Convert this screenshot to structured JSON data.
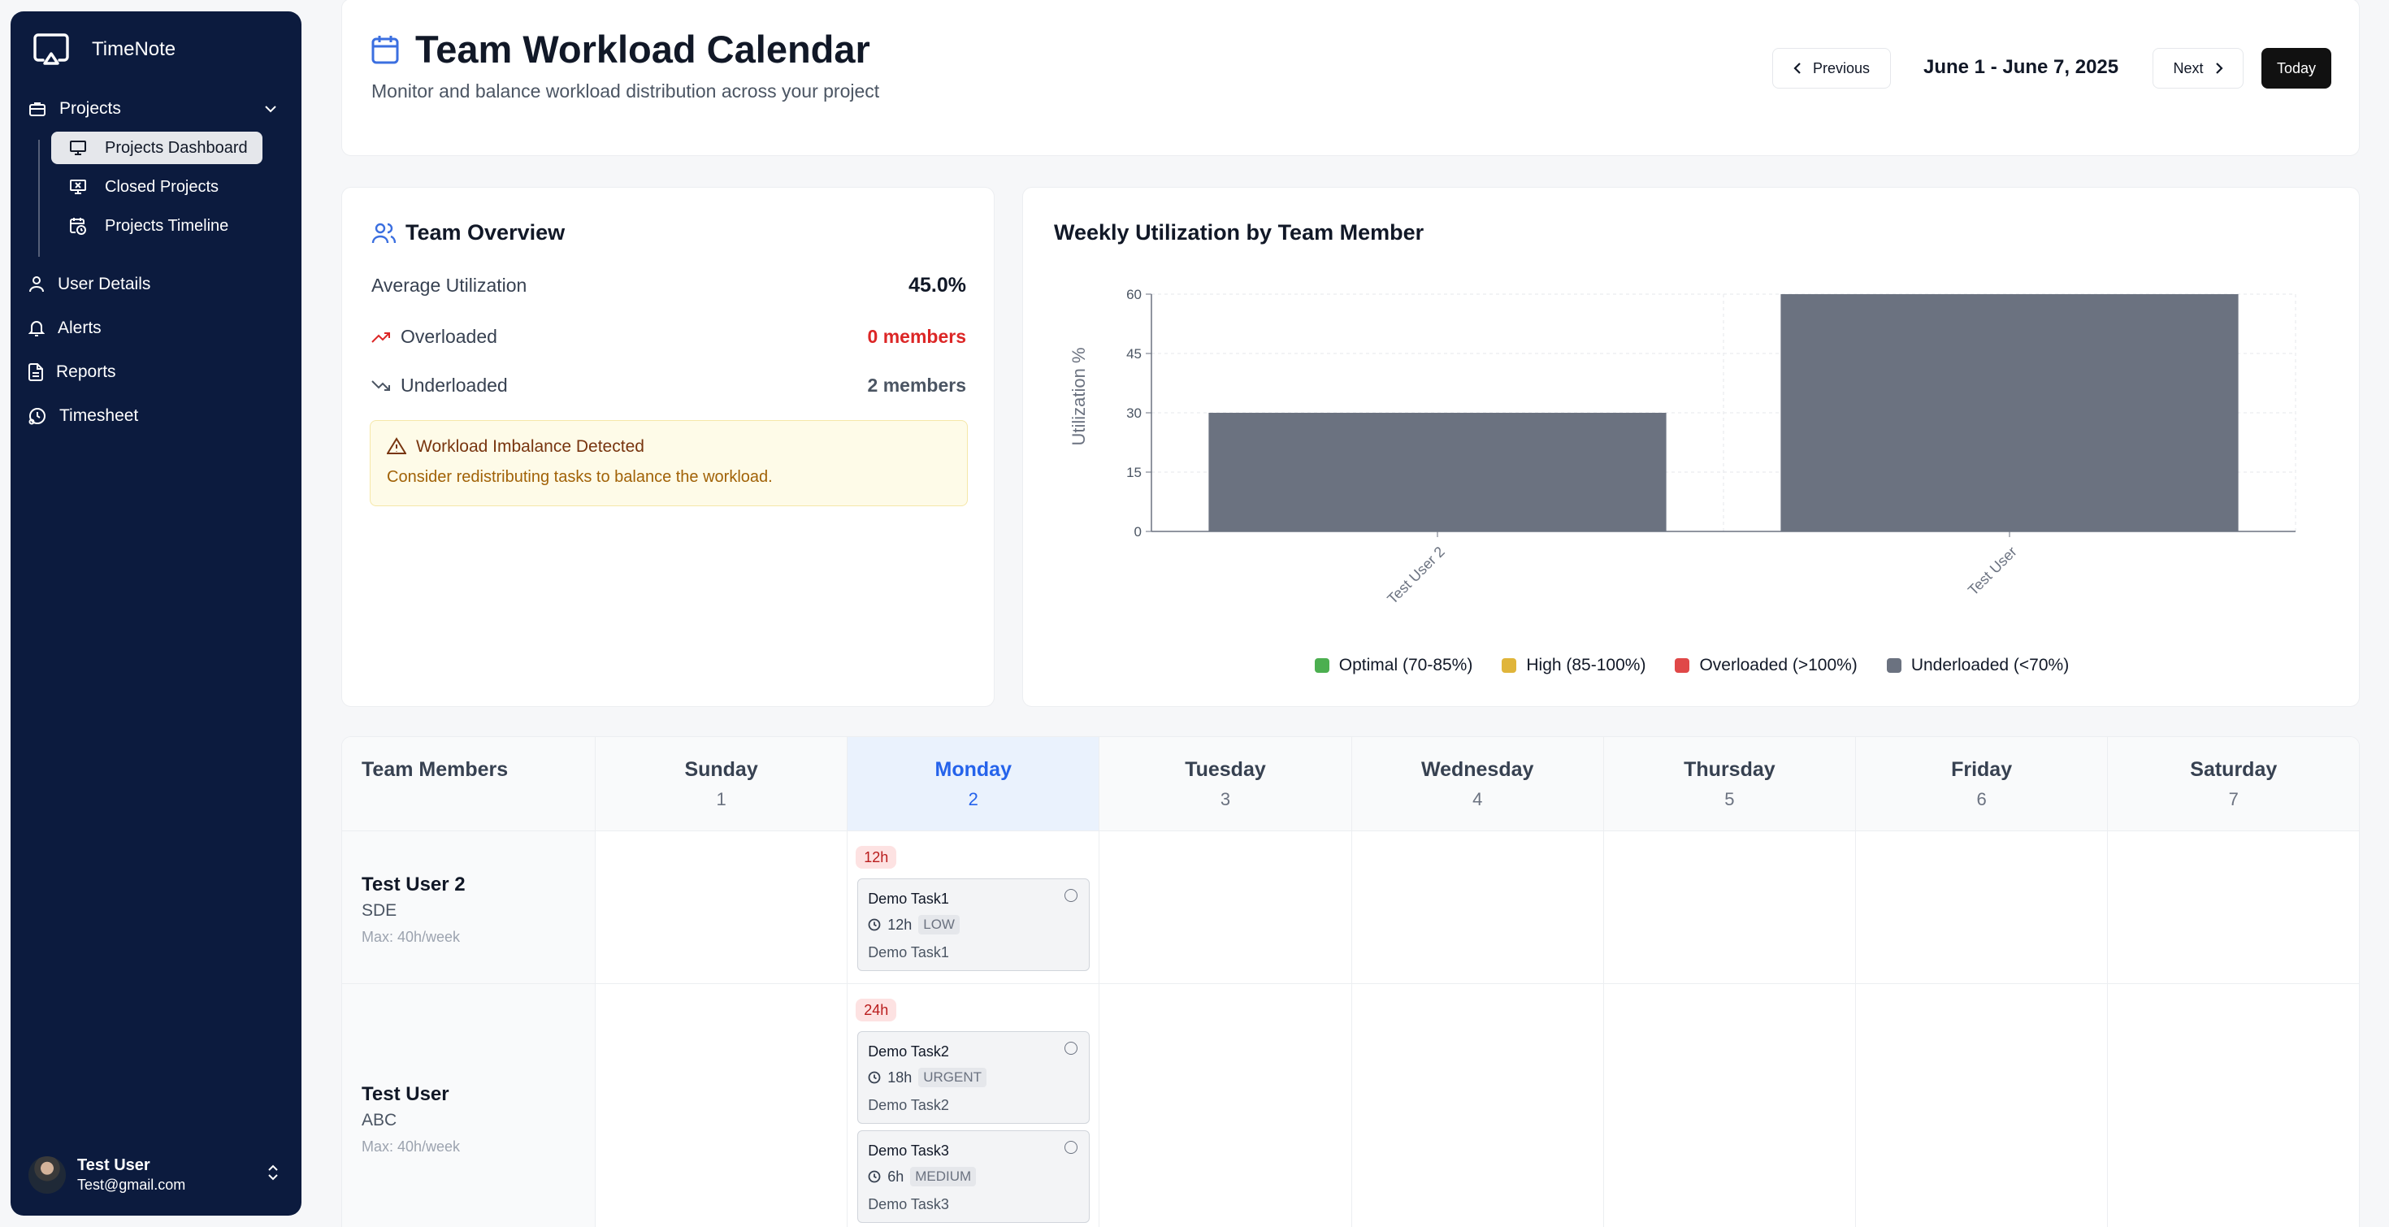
{
  "sidebar": {
    "brand": "TimeNote",
    "projects_label": "Projects",
    "sub_items": [
      "Projects Dashboard",
      "Closed Projects",
      "Projects Timeline"
    ],
    "items": [
      "User Details",
      "Alerts",
      "Reports",
      "Timesheet"
    ],
    "user": {
      "name": "Test User",
      "email": "Test@gmail.com"
    }
  },
  "header": {
    "title": "Team Workload Calendar",
    "subtitle": "Monitor and balance workload distribution across your project",
    "previous_label": "Previous",
    "date_range": "June 1 - June 7, 2025",
    "next_label": "Next",
    "today_label": "Today"
  },
  "overview": {
    "title": "Team Overview",
    "avg_label": "Average Utilization",
    "avg_value": "45.0%",
    "overloaded_label": "Overloaded",
    "overloaded_value": "0 members",
    "underloaded_label": "Underloaded",
    "underloaded_value": "2 members",
    "alert_title": "Workload Imbalance Detected",
    "alert_text": "Consider redistributing tasks to balance the workload."
  },
  "chart_data": {
    "type": "bar",
    "title": "Weekly Utilization by Team Member",
    "ylabel": "Utilization %",
    "categories": [
      "Test User 2",
      "Test User"
    ],
    "values": [
      30,
      60
    ],
    "ylim": [
      0,
      60
    ],
    "yticks": [
      0,
      15,
      30,
      45,
      60
    ],
    "grid": true,
    "bar_color": "#6b7280",
    "legend": [
      {
        "label": "Optimal (70-85%)",
        "color": "#4caf50"
      },
      {
        "label": "High (85-100%)",
        "color": "#e0b53a"
      },
      {
        "label": "Overloaded (>100%)",
        "color": "#e04848"
      },
      {
        "label": "Underloaded (<70%)",
        "color": "#6b7280"
      }
    ]
  },
  "calendar": {
    "members_header": "Team Members",
    "days": [
      {
        "name": "Sunday",
        "num": "1"
      },
      {
        "name": "Monday",
        "num": "2"
      },
      {
        "name": "Tuesday",
        "num": "3"
      },
      {
        "name": "Wednesday",
        "num": "4"
      },
      {
        "name": "Thursday",
        "num": "5"
      },
      {
        "name": "Friday",
        "num": "6"
      },
      {
        "name": "Saturday",
        "num": "7"
      }
    ],
    "members": [
      {
        "name": "Test User 2",
        "role": "SDE",
        "max": "Max: 40h/week",
        "monday_total": "12h",
        "tasks": [
          {
            "name": "Demo Task1",
            "hours": "12h",
            "priority": "LOW",
            "desc": "Demo Task1"
          }
        ]
      },
      {
        "name": "Test User",
        "role": "ABC",
        "max": "Max: 40h/week",
        "monday_total": "24h",
        "tasks": [
          {
            "name": "Demo Task2",
            "hours": "18h",
            "priority": "URGENT",
            "desc": "Demo Task2"
          },
          {
            "name": "Demo Task3",
            "hours": "6h",
            "priority": "MEDIUM",
            "desc": "Demo Task3"
          }
        ]
      }
    ]
  }
}
